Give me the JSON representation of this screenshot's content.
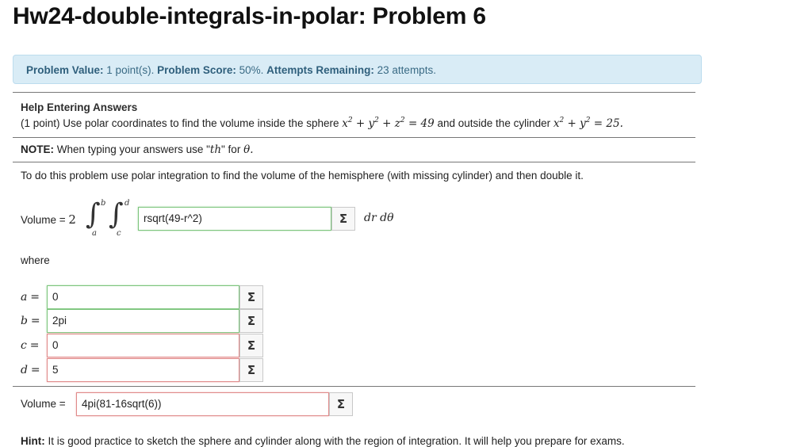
{
  "page": {
    "title": "Hw24-double-integrals-in-polar: Problem 6"
  },
  "status": {
    "value_label": "Problem Value:",
    "value_text": " 1 point(s). ",
    "score_label": "Problem Score:",
    "score_text": " 50%. ",
    "attempts_label": "Attempts Remaining:",
    "attempts_text": " 23 attempts."
  },
  "problem": {
    "help_title": "Help Entering Answers",
    "statement_prefix": "(1 point) Use polar coordinates to find the volume inside the sphere ",
    "sphere_eq": {
      "lhs_x": "x",
      "lhs_y": "y",
      "lhs_z": "z",
      "rhs": "49",
      "exp": "2"
    },
    "statement_mid": " and outside the cylinder ",
    "cylinder_eq": {
      "lhs_x": "x",
      "lhs_y": "y",
      "rhs": "25.",
      "exp": "2"
    },
    "note_label": "NOTE:",
    "note_text": " When typing your answers use \"",
    "note_th": "th",
    "note_for": "\" for ",
    "note_theta": "θ.",
    "instruction": "To do this problem use polar integration to find the volume of the hemisphere (with missing cylinder) and then double it."
  },
  "integral": {
    "volume_label": "Volume = ",
    "factor": "2",
    "outer_upper": "b",
    "outer_lower": "a",
    "inner_upper": "d",
    "inner_lower": "c",
    "integrand_value": "rsqrt(49-r^2)",
    "differentials": "dr dθ"
  },
  "where_label": "where",
  "limits": [
    {
      "label": "a",
      "value": "0",
      "status": "correct"
    },
    {
      "label": "b",
      "value": "2pi",
      "status": "correct"
    },
    {
      "label": "c",
      "value": "0",
      "status": "wrong"
    },
    {
      "label": "d",
      "value": "5",
      "status": "wrong"
    }
  ],
  "final": {
    "volume_label": "Volume = ",
    "value": "4pi(81-16sqrt(6))"
  },
  "equals": "=",
  "plus": "+",
  "sigma_glyph": "Σ",
  "hint": {
    "label": "Hint:",
    "text": " It is good practice to sketch the sphere and cylinder along with the region of integration. It will help you prepare for exams."
  }
}
